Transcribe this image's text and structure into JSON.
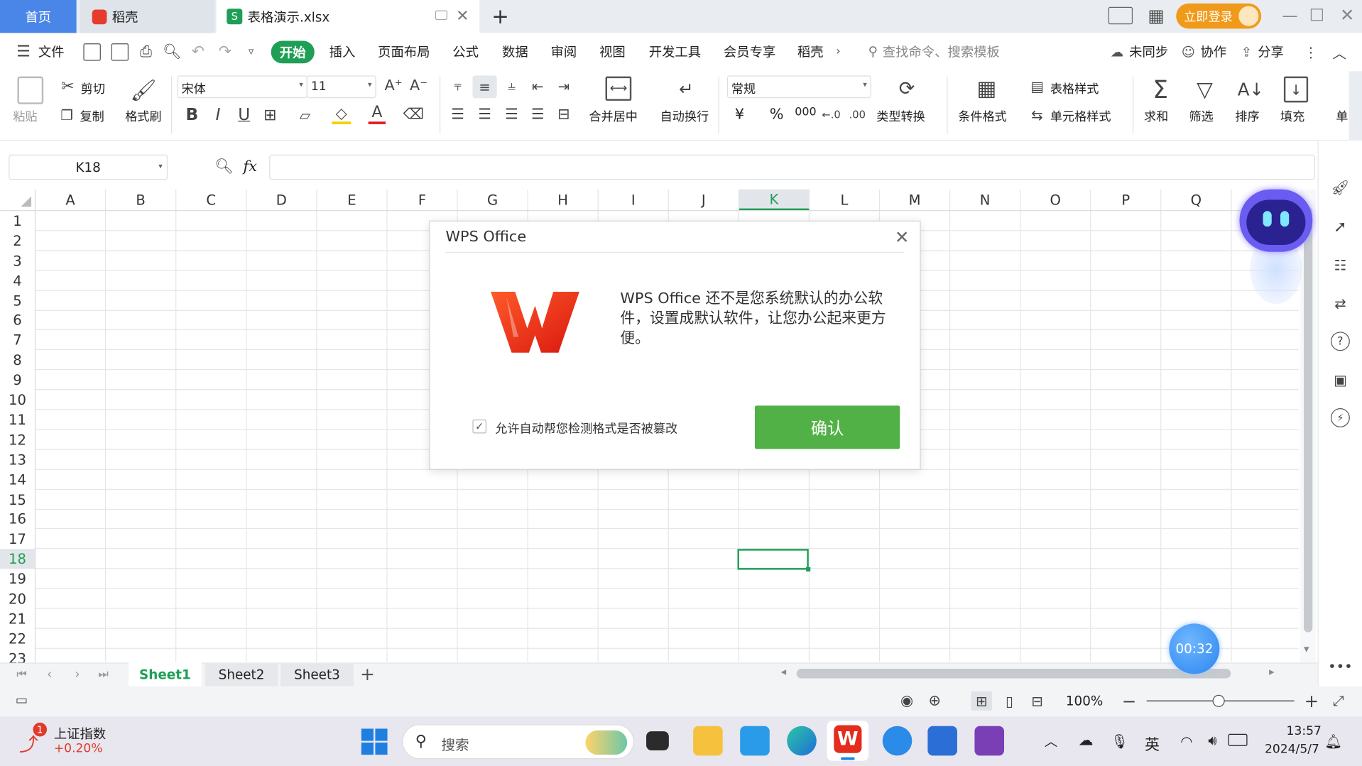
{
  "tabs": {
    "home": "首页",
    "daoke": "稻壳",
    "file": "表格演示.xlsx",
    "login": "立即登录"
  },
  "menu": [
    "文件",
    "开始",
    "插入",
    "页面布局",
    "公式",
    "数据",
    "审阅",
    "视图",
    "开发工具",
    "会员专享",
    "稻壳"
  ],
  "menu_right": {
    "search_placeholder": "查找命令、搜索模板",
    "sync": "未同步",
    "collab": "协作",
    "share": "分享"
  },
  "ribbon": {
    "paste": "粘贴",
    "cut": "剪切",
    "copy": "复制",
    "format_painter": "格式刷",
    "font_name": "宋体",
    "font_size": "11",
    "merge": "合并居中",
    "wrap": "自动换行",
    "number_format": "常规",
    "type_convert": "类型转换",
    "cond_format": "条件格式",
    "table_style": "表格样式",
    "cell_style": "单元格样式",
    "sum": "求和",
    "filter": "筛选",
    "sort": "排序",
    "fill": "填充",
    "cell": "单",
    "currency": "¥",
    "percent": "%",
    "thousands": "000"
  },
  "formula_bar": {
    "cell_ref": "K18",
    "fx": "fx",
    "value": ""
  },
  "columns": [
    "A",
    "B",
    "C",
    "D",
    "E",
    "F",
    "G",
    "H",
    "I",
    "J",
    "K",
    "L",
    "M",
    "N",
    "O",
    "P",
    "Q"
  ],
  "rows": [
    "1",
    "2",
    "3",
    "4",
    "5",
    "6",
    "7",
    "8",
    "9",
    "10",
    "11",
    "12",
    "13",
    "14",
    "15",
    "16",
    "17",
    "18",
    "19",
    "20",
    "21",
    "22",
    "23"
  ],
  "active_cell": {
    "column": "K",
    "row": "18"
  },
  "sheets": {
    "s1": "Sheet1",
    "s2": "Sheet2",
    "s3": "Sheet3"
  },
  "status": {
    "zoom": "100%"
  },
  "timer": "00:32",
  "dialog": {
    "title": "WPS Office",
    "message": "WPS Office 还不是您系统默认的办公软件，设置成默认软件，让您办公起来更方便。",
    "checkbox_label": "允许自动帮您检测格式是否被篡改",
    "checkbox_checked": true,
    "confirm": "确认"
  },
  "taskbar": {
    "stock_name": "上证指数",
    "stock_change": "+0.20%",
    "badge": "1",
    "search": "搜索",
    "ime": "英",
    "time": "13:57",
    "date": "2024/5/7"
  },
  "colors": {
    "accent_green": "#1e9f55",
    "confirm_green": "#52b146",
    "tab_blue": "#4a86e8",
    "login_orange": "#f09a1a"
  }
}
